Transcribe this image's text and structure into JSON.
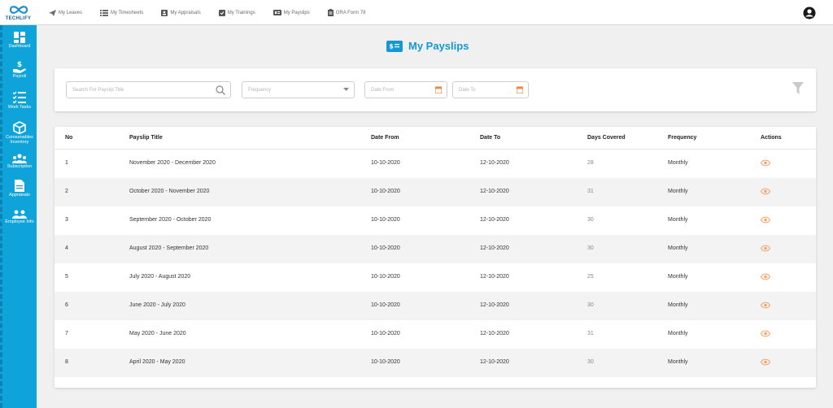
{
  "app": {
    "brand": "TECHLIFY",
    "accent_color": "#0ea3d9",
    "action_color": "#f2a56b"
  },
  "top_nav": [
    {
      "label": "My Leaves",
      "icon": "paper-plane-icon"
    },
    {
      "label": "My Timesheets",
      "icon": "list-icon"
    },
    {
      "label": "My Appraisals",
      "icon": "id-card-icon"
    },
    {
      "label": "My Trainings",
      "icon": "clipboard-check-icon"
    },
    {
      "label": "My Payslips",
      "icon": "payslip-icon"
    },
    {
      "label": "GRA Form 78",
      "icon": "form-icon"
    }
  ],
  "sidebar": [
    {
      "label": "Dashboard",
      "icon": "dashboard-icon"
    },
    {
      "label": "Payroll",
      "icon": "payroll-icon"
    },
    {
      "label": "Work Tasks",
      "icon": "tasks-icon"
    },
    {
      "label": "Consumables Inventory",
      "icon": "box-icon"
    },
    {
      "label": "Subscription",
      "icon": "users-icon"
    },
    {
      "label": "Appraisals",
      "icon": "document-icon"
    },
    {
      "label": "Employee Info",
      "icon": "group-icon"
    }
  ],
  "page": {
    "title": "My Payslips"
  },
  "filters": {
    "search_placeholder": "Search For Payslip Title",
    "frequency_placeholder": "Frequency",
    "date_from_placeholder": "Date From",
    "date_to_placeholder": "Date To"
  },
  "table": {
    "headers": {
      "no": "No",
      "title": "Payslip Title",
      "date_from": "Date From",
      "date_to": "Date To",
      "days": "Days Covered",
      "frequency": "Frequency",
      "actions": "Actions"
    },
    "rows": [
      {
        "no": "1",
        "title": "November 2020 - December 2020",
        "date_from": "10-10-2020",
        "date_to": "12-10-2020",
        "days": "28",
        "frequency": "Monthly"
      },
      {
        "no": "2",
        "title": "October 2020 - November 2020",
        "date_from": "10-10-2020",
        "date_to": "12-10-2020",
        "days": "31",
        "frequency": "Monthly"
      },
      {
        "no": "3",
        "title": "September 2020 - October 2020",
        "date_from": "10-10-2020",
        "date_to": "12-10-2020",
        "days": "30",
        "frequency": "Monthly"
      },
      {
        "no": "4",
        "title": "August 2020 - September 2020",
        "date_from": "10-10-2020",
        "date_to": "12-10-2020",
        "days": "30",
        "frequency": "Monthly"
      },
      {
        "no": "5",
        "title": "July 2020 - August 2020",
        "date_from": "10-10-2020",
        "date_to": "12-10-2020",
        "days": "25",
        "frequency": "Monthly"
      },
      {
        "no": "6",
        "title": "June 2020 - July 2020",
        "date_from": "10-10-2020",
        "date_to": "12-10-2020",
        "days": "30",
        "frequency": "Monthly"
      },
      {
        "no": "7",
        "title": "May 2020 - June 2020",
        "date_from": "10-10-2020",
        "date_to": "12-10-2020",
        "days": "31",
        "frequency": "Monthly"
      },
      {
        "no": "8",
        "title": "April 2020 - May 2020",
        "date_from": "10-10-2020",
        "date_to": "12-10-2020",
        "days": "30",
        "frequency": "Monthly"
      }
    ]
  }
}
